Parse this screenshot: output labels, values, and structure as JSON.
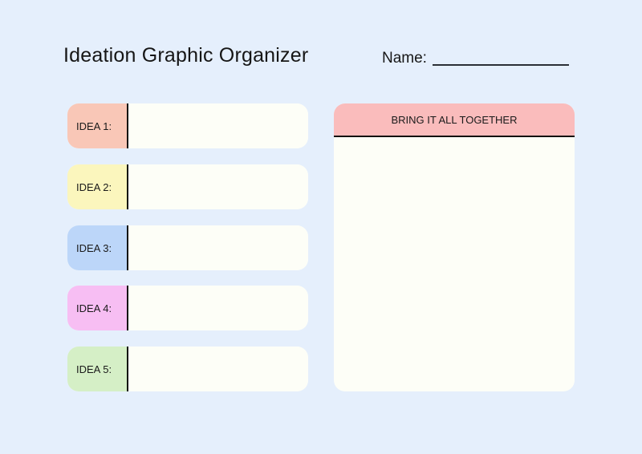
{
  "title": "Ideation Graphic Organizer",
  "name_label": "Name:",
  "name_value": "",
  "ideas": [
    {
      "label": "IDEA 1:",
      "color": "#f9c7b7",
      "value": ""
    },
    {
      "label": "IDEA 2:",
      "color": "#fbf6bd",
      "value": ""
    },
    {
      "label": "IDEA 3:",
      "color": "#bcd6f9",
      "value": ""
    },
    {
      "label": "IDEA 4:",
      "color": "#f7bef3",
      "value": ""
    },
    {
      "label": "IDEA 5:",
      "color": "#d5efc6",
      "value": ""
    }
  ],
  "together": {
    "header": "BRING IT ALL TOGETHER",
    "header_color": "#fabcbc",
    "value": ""
  }
}
